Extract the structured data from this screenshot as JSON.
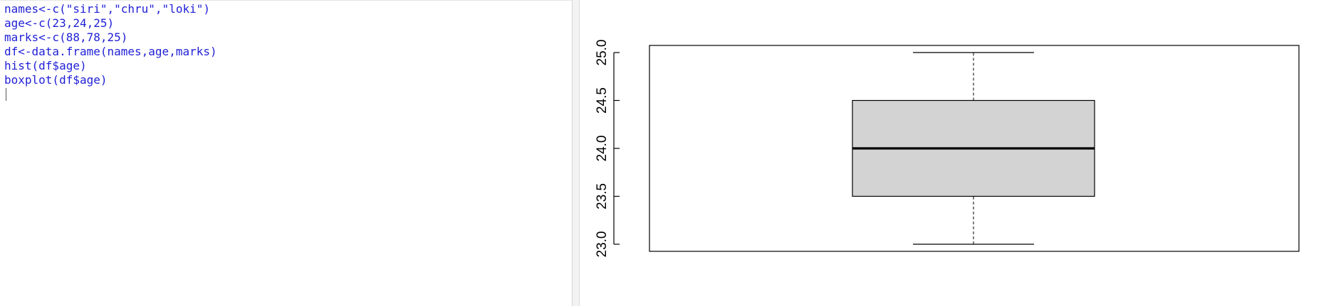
{
  "editor": {
    "lines": [
      "names<-c(\"siri\",\"chru\",\"loki\")",
      "age<-c(23,24,25)",
      "marks<-c(88,78,25)",
      "df<-data.frame(names,age,marks)",
      "hist(df$age)",
      "boxplot(df$age)"
    ],
    "text_color": "#1f1fd6"
  },
  "plot": {
    "chart_data": {
      "type": "boxplot",
      "title": "",
      "xlabel": "",
      "ylabel": "",
      "ylim": [
        23.0,
        25.0
      ],
      "y_ticks": [
        23.0,
        23.5,
        24.0,
        24.5,
        25.0
      ],
      "y_tick_labels": [
        "23.0",
        "23.5",
        "24.0",
        "24.5",
        "25.0"
      ],
      "series": [
        {
          "min": 23.0,
          "q1": 23.5,
          "median": 24.0,
          "q3": 24.5,
          "max": 25.0
        }
      ],
      "box_fill": "#d3d3d3"
    }
  }
}
